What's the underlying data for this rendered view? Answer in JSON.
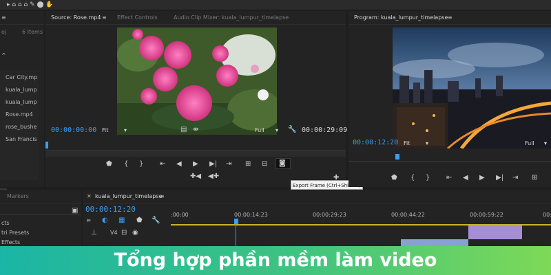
{
  "project_panel": {
    "menu_icon": "hamburger-icon",
    "project_label": "oj",
    "items_count": "6 Items",
    "items": [
      "Car City.mp",
      "kuala_lump",
      "kuala_lump",
      "Rose.mp4",
      "rose_bushe",
      "San Francis"
    ]
  },
  "source_panel": {
    "tabs": [
      "Source: Rose.mp4",
      "Effect Controls",
      "Audio Clip Mixer: kuala_lumpur_timelapse"
    ],
    "timecode_in": "00:00:00:00",
    "fit_label": "Fit",
    "full_label": "Full",
    "timecode_out": "00:00:29:09"
  },
  "program_panel": {
    "tab": "Program: kuala_lumpur_timelapse",
    "timecode": "00:00:12:20",
    "fit_label": "Fit",
    "full_label": "Full"
  },
  "tooltip": {
    "text": "Export Frame (Ctrl+Shift+E)"
  },
  "markers_panel": {
    "tab": "Markers",
    "items": [
      "cts",
      "tri Presets",
      "Effects"
    ]
  },
  "timeline": {
    "tab": "kuala_lumpur_timelapse",
    "timecode": "00:00:12:20",
    "ruler_labels": [
      ":00:00",
      "00:00:14:23",
      "00:00:29:23",
      "00:00:44:22",
      "00:00:59:22",
      "00:0"
    ],
    "track_label": "V4"
  },
  "banner": {
    "text": "Tổng hợp phần mềm làm video",
    "colors": [
      "#1bb5a6",
      "#7ed957"
    ]
  }
}
